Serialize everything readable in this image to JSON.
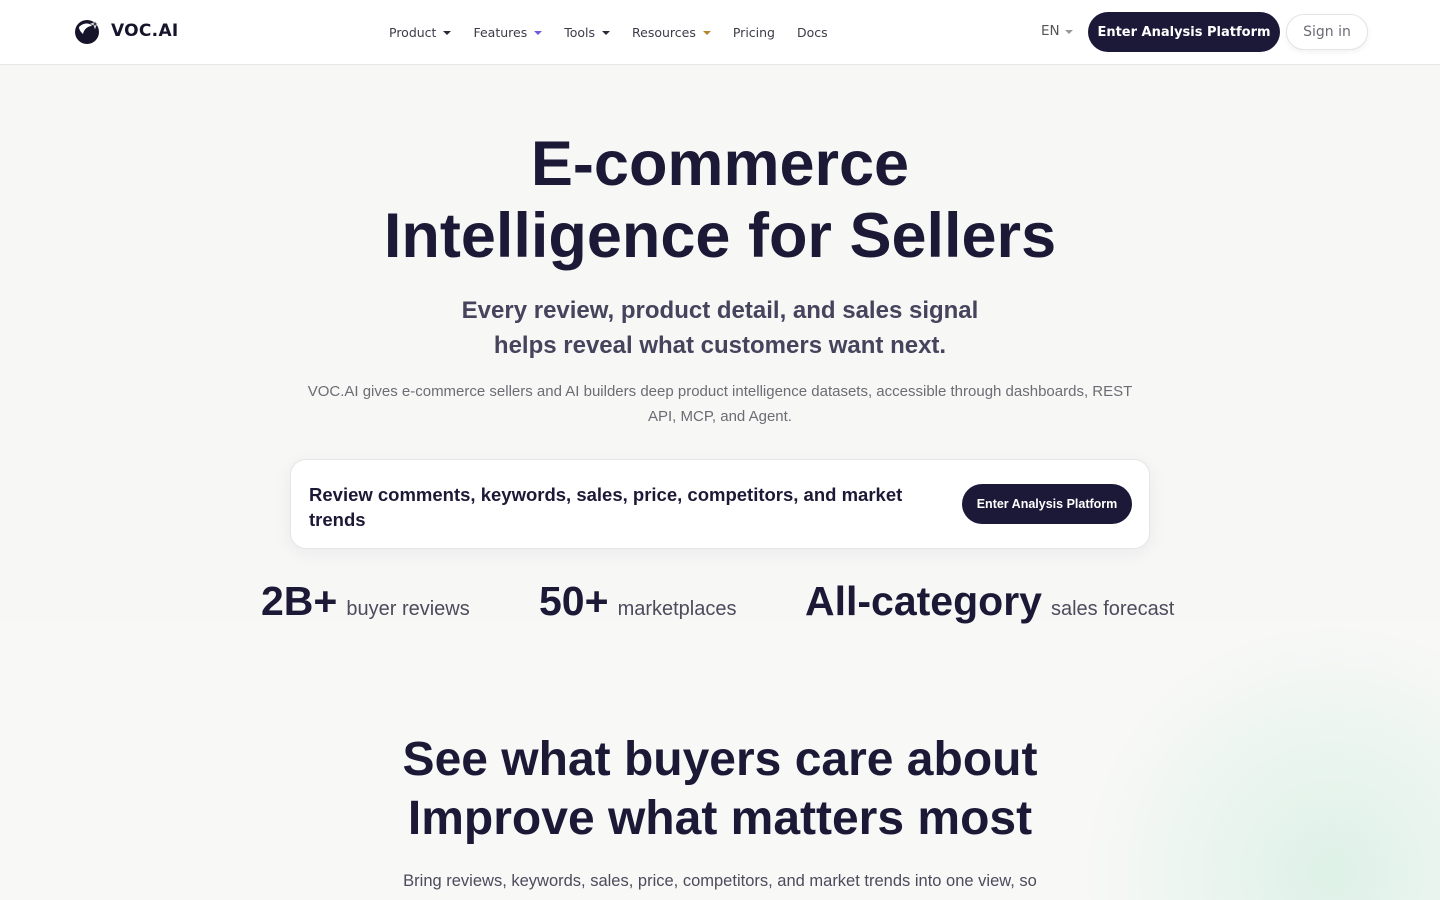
{
  "brand": {
    "name": "VOC.AI"
  },
  "nav": {
    "items": [
      {
        "label": "Product",
        "dropdown": true,
        "caret_color": "#2a2a36"
      },
      {
        "label": "Features",
        "dropdown": true,
        "caret_color": "#6b5ed6"
      },
      {
        "label": "Tools",
        "dropdown": true,
        "caret_color": "#2a2a36"
      },
      {
        "label": "Resources",
        "dropdown": true,
        "caret_color": "#b7862a"
      },
      {
        "label": "Pricing",
        "dropdown": false
      },
      {
        "label": "Docs",
        "dropdown": false
      }
    ],
    "language": "EN",
    "primary_cta": "Enter Analysis Platform",
    "sign_in": "Sign in"
  },
  "hero": {
    "title_line1": "E-commerce",
    "title_line2": "Intelligence for Sellers",
    "subtitle_line1": "Every review, product detail, and sales signal",
    "subtitle_line2": "helps reveal what customers want next.",
    "description": "VOC.AI gives e-commerce sellers and AI builders deep product intelligence datasets, accessible through dashboards, REST API, MCP, and Agent.",
    "search_card": {
      "text": "Review comments, keywords, sales, price, competitors, and market trends",
      "button": "Enter Analysis Platform"
    },
    "stats": [
      {
        "value": "2B+",
        "label": "buyer reviews"
      },
      {
        "value": "50+",
        "label": "marketplaces"
      },
      {
        "value": "All-category",
        "label": "sales forecast"
      }
    ]
  },
  "section2": {
    "title_line1": "See what buyers care about",
    "title_line2": "Improve what matters most",
    "description": "Bring reviews, keywords, sales, price, competitors, and market trends into one view, so"
  },
  "colors": {
    "primary": "#1c1938",
    "text_dark": "#1c1936",
    "text_muted": "#6c6c74",
    "background": "#f7f7f6"
  }
}
